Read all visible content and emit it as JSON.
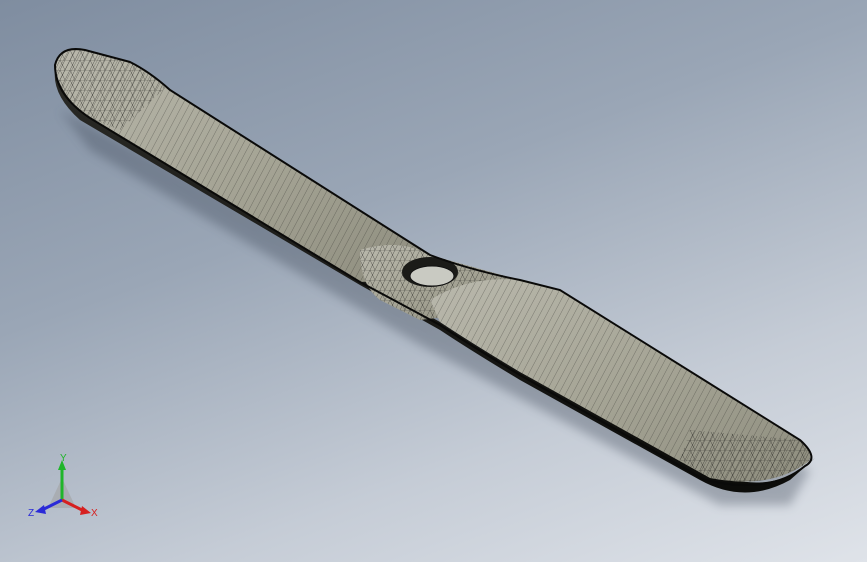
{
  "viewport": {
    "background_top": "#7f8da0",
    "background_bottom": "#dfe3e9",
    "model": {
      "name": "propeller",
      "display_mode": "wireframe-shaded",
      "hub_hole": true
    }
  },
  "triad": {
    "x_label": "X",
    "y_label": "Y",
    "z_label": "Z",
    "x_color": "#d62020",
    "y_color": "#1fb52a",
    "z_color": "#2a2ad8"
  }
}
